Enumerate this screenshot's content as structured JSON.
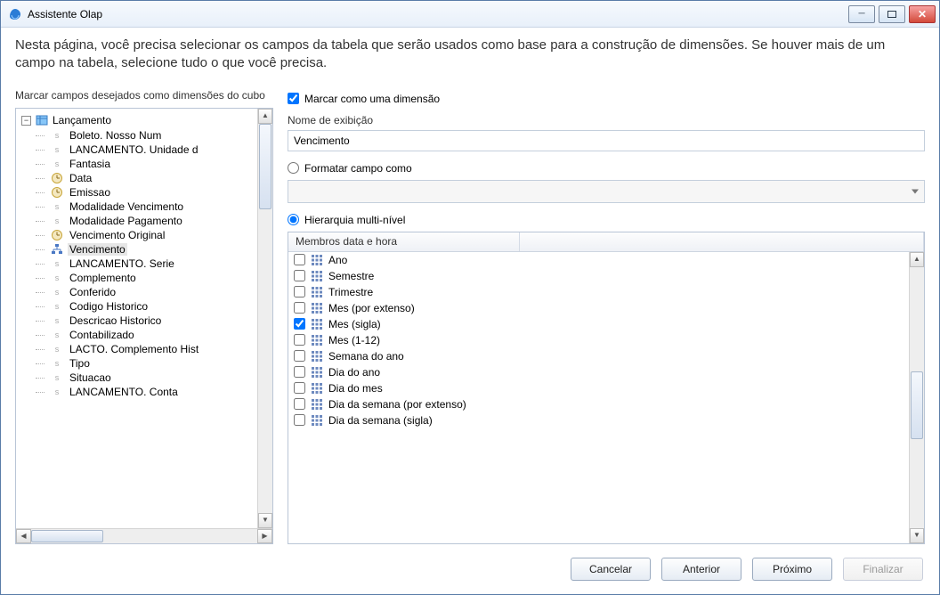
{
  "window": {
    "title": "Assistente Olap"
  },
  "header": {
    "text": "Nesta página, você precisa selecionar os campos da tabela que serão usados como base para a construção de dimensões. Se houver mais de um campo na tabela, selecione tudo o que você precisa."
  },
  "left": {
    "label": "Marcar campos desejados como dimensões do cubo",
    "rootLabel": "Lançamento",
    "items": [
      {
        "label": "Boleto. Nosso Num",
        "icon": "s"
      },
      {
        "label": "LANCAMENTO. Unidade d",
        "icon": "s"
      },
      {
        "label": "Fantasia",
        "icon": "s"
      },
      {
        "label": "Data",
        "icon": "clock"
      },
      {
        "label": "Emissao",
        "icon": "clock"
      },
      {
        "label": "Modalidade Vencimento",
        "icon": "s"
      },
      {
        "label": "Modalidade Pagamento",
        "icon": "s"
      },
      {
        "label": "Vencimento Original",
        "icon": "clock"
      },
      {
        "label": "Vencimento",
        "icon": "hier",
        "selected": true
      },
      {
        "label": "LANCAMENTO. Serie",
        "icon": "s"
      },
      {
        "label": "Complemento",
        "icon": "s"
      },
      {
        "label": "Conferido",
        "icon": "s"
      },
      {
        "label": "Codigo Historico",
        "icon": "s"
      },
      {
        "label": "Descricao Historico",
        "icon": "s"
      },
      {
        "label": "Contabilizado",
        "icon": "s"
      },
      {
        "label": "LACTO. Complemento Hist",
        "icon": "s"
      },
      {
        "label": "Tipo",
        "icon": "s"
      },
      {
        "label": "Situacao",
        "icon": "s"
      },
      {
        "label": "LANCAMENTO. Conta",
        "icon": "s"
      }
    ]
  },
  "right": {
    "markAsDimension": "Marcar como uma dimensão",
    "displayNameLabel": "Nome de exibição",
    "displayNameValue": "Vencimento",
    "formatFieldAs": "Formatar campo como",
    "hierarchyMulti": "Hierarquia multi-nível",
    "listHeader": "Membros data e hora",
    "members": [
      {
        "label": "Ano",
        "checked": false
      },
      {
        "label": "Semestre",
        "checked": false
      },
      {
        "label": "Trimestre",
        "checked": false
      },
      {
        "label": "Mes (por extenso)",
        "checked": false
      },
      {
        "label": "Mes (sigla)",
        "checked": true
      },
      {
        "label": "Mes (1-12)",
        "checked": false
      },
      {
        "label": "Semana do ano",
        "checked": false
      },
      {
        "label": "Dia do ano",
        "checked": false
      },
      {
        "label": "Dia do mes",
        "checked": false
      },
      {
        "label": "Dia da semana (por extenso)",
        "checked": false
      },
      {
        "label": "Dia da semana (sigla)",
        "checked": false
      }
    ]
  },
  "footer": {
    "cancel": "Cancelar",
    "back": "Anterior",
    "next": "Próximo",
    "finish": "Finalizar"
  }
}
